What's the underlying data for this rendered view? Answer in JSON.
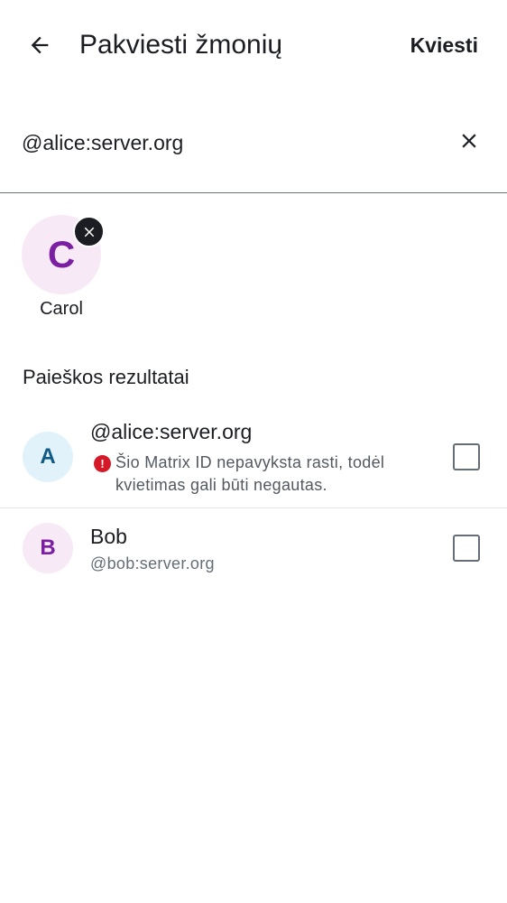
{
  "header": {
    "title": "Pakviesti žmonių",
    "invite_label": "Kviesti",
    "back_icon": "arrow-left-icon"
  },
  "search": {
    "value": "@alice:server.org",
    "clear_icon": "close-icon"
  },
  "selected": [
    {
      "initial": "C",
      "name": "Carol",
      "avatar_bg": "#f8e9f7",
      "avatar_fg": "#7a1fa2",
      "remove_icon": "close-icon"
    }
  ],
  "results": {
    "header": "Paieškos rezultatai",
    "items": [
      {
        "initial": "A",
        "name": "@alice:server.org",
        "warning": "Šio Matrix ID nepavyksta rasti, todėl kvietimas gali būti negautas.",
        "warning_icon": "error-icon",
        "checked": false,
        "avatar_bg": "#e1f2fa",
        "avatar_fg": "#0f5b85"
      },
      {
        "initial": "B",
        "name": "Bob",
        "subtitle": "@bob:server.org",
        "checked": false,
        "avatar_bg": "#f8e9f7",
        "avatar_fg": "#7a1fa2"
      }
    ]
  },
  "colors": {
    "text_primary": "#1b1d22",
    "text_secondary": "#656d77",
    "error": "#d51928",
    "divider": "#e3e5e8"
  }
}
